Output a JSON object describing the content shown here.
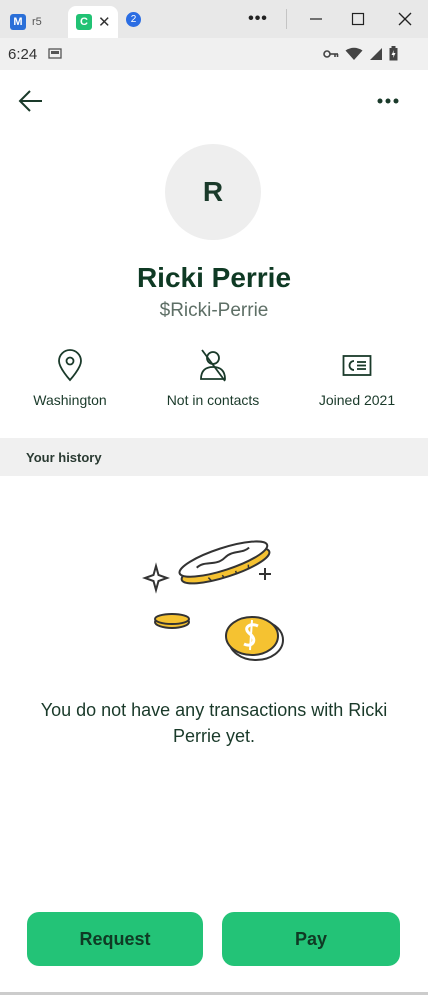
{
  "browser": {
    "tabs": [
      {
        "favicon": "M",
        "label": "r5"
      },
      {
        "favicon": "C",
        "label": ""
      }
    ],
    "tab_count_badge": "2",
    "window_menu": "•••"
  },
  "statusbar": {
    "time": "6:24"
  },
  "profile": {
    "avatar_initial": "R",
    "name": "Ricki Perrie",
    "handle": "$Ricki-Perrie"
  },
  "info": {
    "location": "Washington",
    "contacts": "Not in contacts",
    "joined": "Joined 2021"
  },
  "history": {
    "title": "Your history",
    "empty_message": "You do not have any transactions with Ricki Perrie yet."
  },
  "actions": {
    "request_label": "Request",
    "pay_label": "Pay"
  },
  "colors": {
    "brand_green": "#23c377",
    "text_dark_green": "#0f3a24",
    "coin_yellow": "#f5c231"
  }
}
